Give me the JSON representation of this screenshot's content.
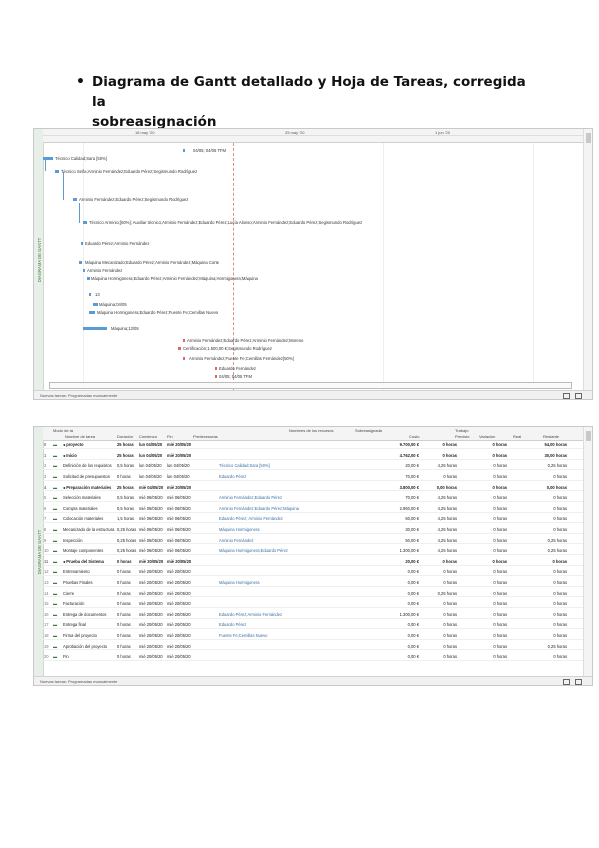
{
  "heading": {
    "bullet": "•",
    "line1": "Diagrama de Gantt detallado y Hoja de Tareas, corregida la",
    "line2": "sobreasignación"
  },
  "gantt_window": {
    "side_label": "DIAGRAMA DE GANTT",
    "timescale": {
      "d1": "18 may '20",
      "d2": "25 may '20",
      "d3": "1 jun '20"
    },
    "status_text": "Nuevas tareas: Programadas manualmente",
    "bars": [
      {
        "label": "04/05; 04/05 TFM"
      },
      {
        "label": "Técnico Calidad;Sara [50%]"
      },
      {
        "label": "Técnico Seña;Arminio Fernández;Eduardo Pérez;Segismundo Rodríguez"
      },
      {
        "label": "Arminio Fernández;Eduardo Pérez;Segismundo Rodríguez"
      },
      {
        "label": "Técnico Arminio;[50%]; Auxiliar técnico;Arminio Fernández;Eduardo Pérez;Lucía Alonso;Arminio Fernández;Eduardo Pérez;Segismundo Rodríguez"
      },
      {
        "label": "Eduardo Pérez;Arminio Fernández"
      },
      {
        "label": "Máquina Mecanizado;Eduardo Pérez;Arminio Fernández;Máquina Corte"
      },
      {
        "label": "Arminio Fernández"
      },
      {
        "label": "Máquina Hormigonera;Eduardo Pérez;Arminio Fernández;Máquina;Hormigonera;Máquina"
      },
      {
        "label": "13"
      },
      {
        "label": "Máquina;04/05"
      },
      {
        "label": "Máquina Hormigonera;Eduardo Pérez;Fuente Fe;Cemillas Nuevo"
      },
      {
        "label": "Máquina;13/05"
      },
      {
        "label": "Arminio Fernández;Eduardo Pérez;Arminio Fernández;Moreno"
      },
      {
        "label": "Certificación;1.500,00 €;Segismundo Rodríguez"
      },
      {
        "label": "Arminio Fernández;Fuente Fe;Cemillas Fernández[50%]"
      },
      {
        "label": "Eduardo Fernández"
      },
      {
        "label": "04/05; 04/05 TFM"
      }
    ]
  },
  "table_window": {
    "side_label": "DIAGRAMA DE GANTT",
    "status_text": "Nuevas tareas: Programadas manualmente",
    "headers": {
      "mode": "Modo de tarea",
      "name": "Nombre de tarea",
      "duration": "Duración",
      "start": "Comienzo",
      "finish": "Fin",
      "pred": "Predecesoras",
      "res": "Nombres de los recursos",
      "over": "Sobreasignada",
      "cost": "Costo",
      "work": "Trabajo",
      "baseline": "Previsto",
      "variance": "Variación",
      "actual": "Real",
      "remaining": "Restante"
    },
    "rows": [
      {
        "n": "0",
        "icon": "▬",
        "name": "◂ proyecto",
        "dur": "25 horas",
        "start": "lun 04/05/20",
        "finish": "mié 20/05/20",
        "res": "",
        "over": "",
        "cost": "9.700,00 €",
        "work": "0 horas",
        "base": "0 horas",
        "act": "54,00 horas",
        "sum": true
      },
      {
        "n": "1",
        "icon": "▬",
        "name": "◂ Inicio",
        "dur": "25 horas",
        "start": "lun 04/05/20",
        "finish": "mié 20/05/20",
        "res": "",
        "over": "",
        "cost": "4.762,00 €",
        "work": "0 horas",
        "base": "0 horas",
        "act": "30,00 horas",
        "sum": true
      },
      {
        "n": "2",
        "icon": "▬",
        "name": "Definición de los requisitos",
        "dur": "0,5 horas",
        "start": "lun 04/05/20",
        "finish": "lun 04/05/20",
        "res": "Técnico Calidad;Sara [50%]",
        "over": "",
        "cost": "20,00 €",
        "work": "4,25 horas",
        "base": "0 horas",
        "act": "0,25 horas",
        "sum": false
      },
      {
        "n": "3",
        "icon": "▬",
        "name": "Solicitud de presupuestos",
        "dur": "0 horas",
        "start": "lun 04/05/20",
        "finish": "lun 04/05/20",
        "res": "Eduardo Pérez",
        "over": "",
        "cost": "70,00 €",
        "work": "0 horas",
        "base": "0 horas",
        "act": "0 horas",
        "sum": false
      },
      {
        "n": "4",
        "icon": "▬",
        "name": "◂ Preparación materiales",
        "dur": "25 horas",
        "start": "mié 04/05/20",
        "finish": "mié 20/05/20",
        "res": "",
        "over": "",
        "cost": "3.800,00 €",
        "work": "0,00 horas",
        "base": "0 horas",
        "act": "0,00 horas",
        "sum": true
      },
      {
        "n": "5",
        "icon": "▬",
        "name": "Selección materiales",
        "dur": "0,5 horas",
        "start": "mié 06/05/20",
        "finish": "mié 06/05/20",
        "res": "Arminio Fernández;Eduardo Pérez",
        "over": "",
        "cost": "70,00 €",
        "work": "4,25 horas",
        "base": "0 horas",
        "act": "0 horas",
        "sum": false
      },
      {
        "n": "6",
        "icon": "▬",
        "name": "Compra materiales",
        "dur": "0,5 horas",
        "start": "mié 06/05/20",
        "finish": "mié 06/05/20",
        "res": "Arminio Fernández;Eduardo Pérez;Máquina",
        "over": "",
        "cost": "2.960,00 €",
        "work": "4,25 horas",
        "base": "0 horas",
        "act": "0 horas",
        "sum": false
      },
      {
        "n": "7",
        "icon": "▬",
        "name": "Colocación materiales",
        "dur": "1,5 horas",
        "start": "mié 06/05/20",
        "finish": "mié 06/05/20",
        "res": "Eduardo Pérez; Arminio Fernández",
        "over": "",
        "cost": "60,00 €",
        "work": "4,25 horas",
        "base": "0 horas",
        "act": "0 horas",
        "sum": false
      },
      {
        "n": "8",
        "icon": "▬",
        "name": "Mecanizado de la estructura",
        "dur": "0,25 horas",
        "start": "mié 06/05/20",
        "finish": "mié 06/05/20",
        "res": "Máquina Hormigonera",
        "over": "",
        "cost": "30,00 €",
        "work": "4,25 horas",
        "base": "0 horas",
        "act": "0 horas",
        "sum": false
      },
      {
        "n": "9",
        "icon": "▬",
        "name": "Inspección",
        "dur": "0,25 horas",
        "start": "mié 06/05/20",
        "finish": "mié 06/05/20",
        "res": "Arminio Fernández",
        "over": "",
        "cost": "50,00 €",
        "work": "4,25 horas",
        "base": "0 horas",
        "act": "0,25 horas",
        "sum": false
      },
      {
        "n": "10",
        "icon": "▬",
        "name": "Montaje componentes",
        "dur": "0,25 horas",
        "start": "mié 06/05/20",
        "finish": "mié 06/05/20",
        "res": "Máquina Hormigonera;Eduardo Pérez",
        "over": "",
        "cost": "1.300,00 €",
        "work": "4,25 horas",
        "base": "0 horas",
        "act": "0,25 horas",
        "sum": false
      },
      {
        "n": "11",
        "icon": "▬",
        "name": "◂ Prueba del Sistema",
        "dur": "0 horas",
        "start": "mié 20/05/20",
        "finish": "mié 20/05/20",
        "res": "",
        "over": "",
        "cost": "20,00 €",
        "work": "0 horas",
        "base": "0 horas",
        "act": "0 horas",
        "sum": true
      },
      {
        "n": "12",
        "icon": "▬",
        "name": "Entrenamiento",
        "dur": "0 horas",
        "start": "mié 20/05/20",
        "finish": "mié 20/05/20",
        "res": "",
        "over": "",
        "cost": "0,00 €",
        "work": "0 horas",
        "base": "0 horas",
        "act": "0 horas",
        "sum": false
      },
      {
        "n": "13",
        "icon": "▬",
        "name": "Pruebas Finales",
        "dur": "0 horas",
        "start": "mié 20/05/20",
        "finish": "mié 20/05/20",
        "res": "Máquina Hormigonera",
        "over": "",
        "cost": "0,00 €",
        "work": "0 horas",
        "base": "0 horas",
        "act": "0 horas",
        "sum": false
      },
      {
        "n": "14",
        "icon": "▬",
        "name": "Cierre",
        "dur": "0 horas",
        "start": "mié 20/05/20",
        "finish": "mié 20/05/20",
        "res": "",
        "over": "",
        "cost": "0,00 €",
        "work": "0,25 horas",
        "base": "0 horas",
        "act": "0 horas",
        "sum": false
      },
      {
        "n": "15",
        "icon": "▬",
        "name": "Facturación",
        "dur": "0 horas",
        "start": "mié 20/05/20",
        "finish": "mié 20/05/20",
        "res": "",
        "over": "",
        "cost": "0,00 €",
        "work": "0 horas",
        "base": "0 horas",
        "act": "0 horas",
        "sum": false
      },
      {
        "n": "16",
        "icon": "▬",
        "name": "Entrega de documentos",
        "dur": "0 horas",
        "start": "mié 20/05/20",
        "finish": "mié 20/05/20",
        "res": "Eduardo Pérez;Arminio Fernández",
        "over": "",
        "cost": "1.300,00 €",
        "work": "0 horas",
        "base": "0 horas",
        "act": "0 horas",
        "sum": false
      },
      {
        "n": "17",
        "icon": "▬",
        "name": "Entrega final",
        "dur": "0 horas",
        "start": "mié 20/05/20",
        "finish": "mié 20/05/20",
        "res": "Eduardo Pérez",
        "over": "",
        "cost": "0,00 €",
        "work": "0 horas",
        "base": "0 horas",
        "act": "0 horas",
        "sum": false
      },
      {
        "n": "18",
        "icon": "▬",
        "name": "Firma del proyecto",
        "dur": "0 horas",
        "start": "mié 20/05/20",
        "finish": "mié 20/05/20",
        "res": "Fuente Fe;Cemillas Nuevo",
        "over": "",
        "cost": "0,00 €",
        "work": "0 horas",
        "base": "0 horas",
        "act": "0 horas",
        "sum": false
      },
      {
        "n": "19",
        "icon": "▬",
        "name": "Aprobación del proyecto",
        "dur": "0 horas",
        "start": "mié 20/05/20",
        "finish": "mié 20/05/20",
        "res": "",
        "over": "",
        "cost": "0,00 €",
        "work": "0 horas",
        "base": "0 horas",
        "act": "0,25 horas",
        "sum": false
      },
      {
        "n": "20",
        "icon": "▬",
        "name": "Fin",
        "dur": "0 horas",
        "start": "mié 20/05/20",
        "finish": "mié 20/05/20",
        "res": "",
        "over": "",
        "cost": "0,00 €",
        "work": "0 horas",
        "base": "0 horas",
        "act": "0 horas",
        "sum": false
      }
    ]
  }
}
